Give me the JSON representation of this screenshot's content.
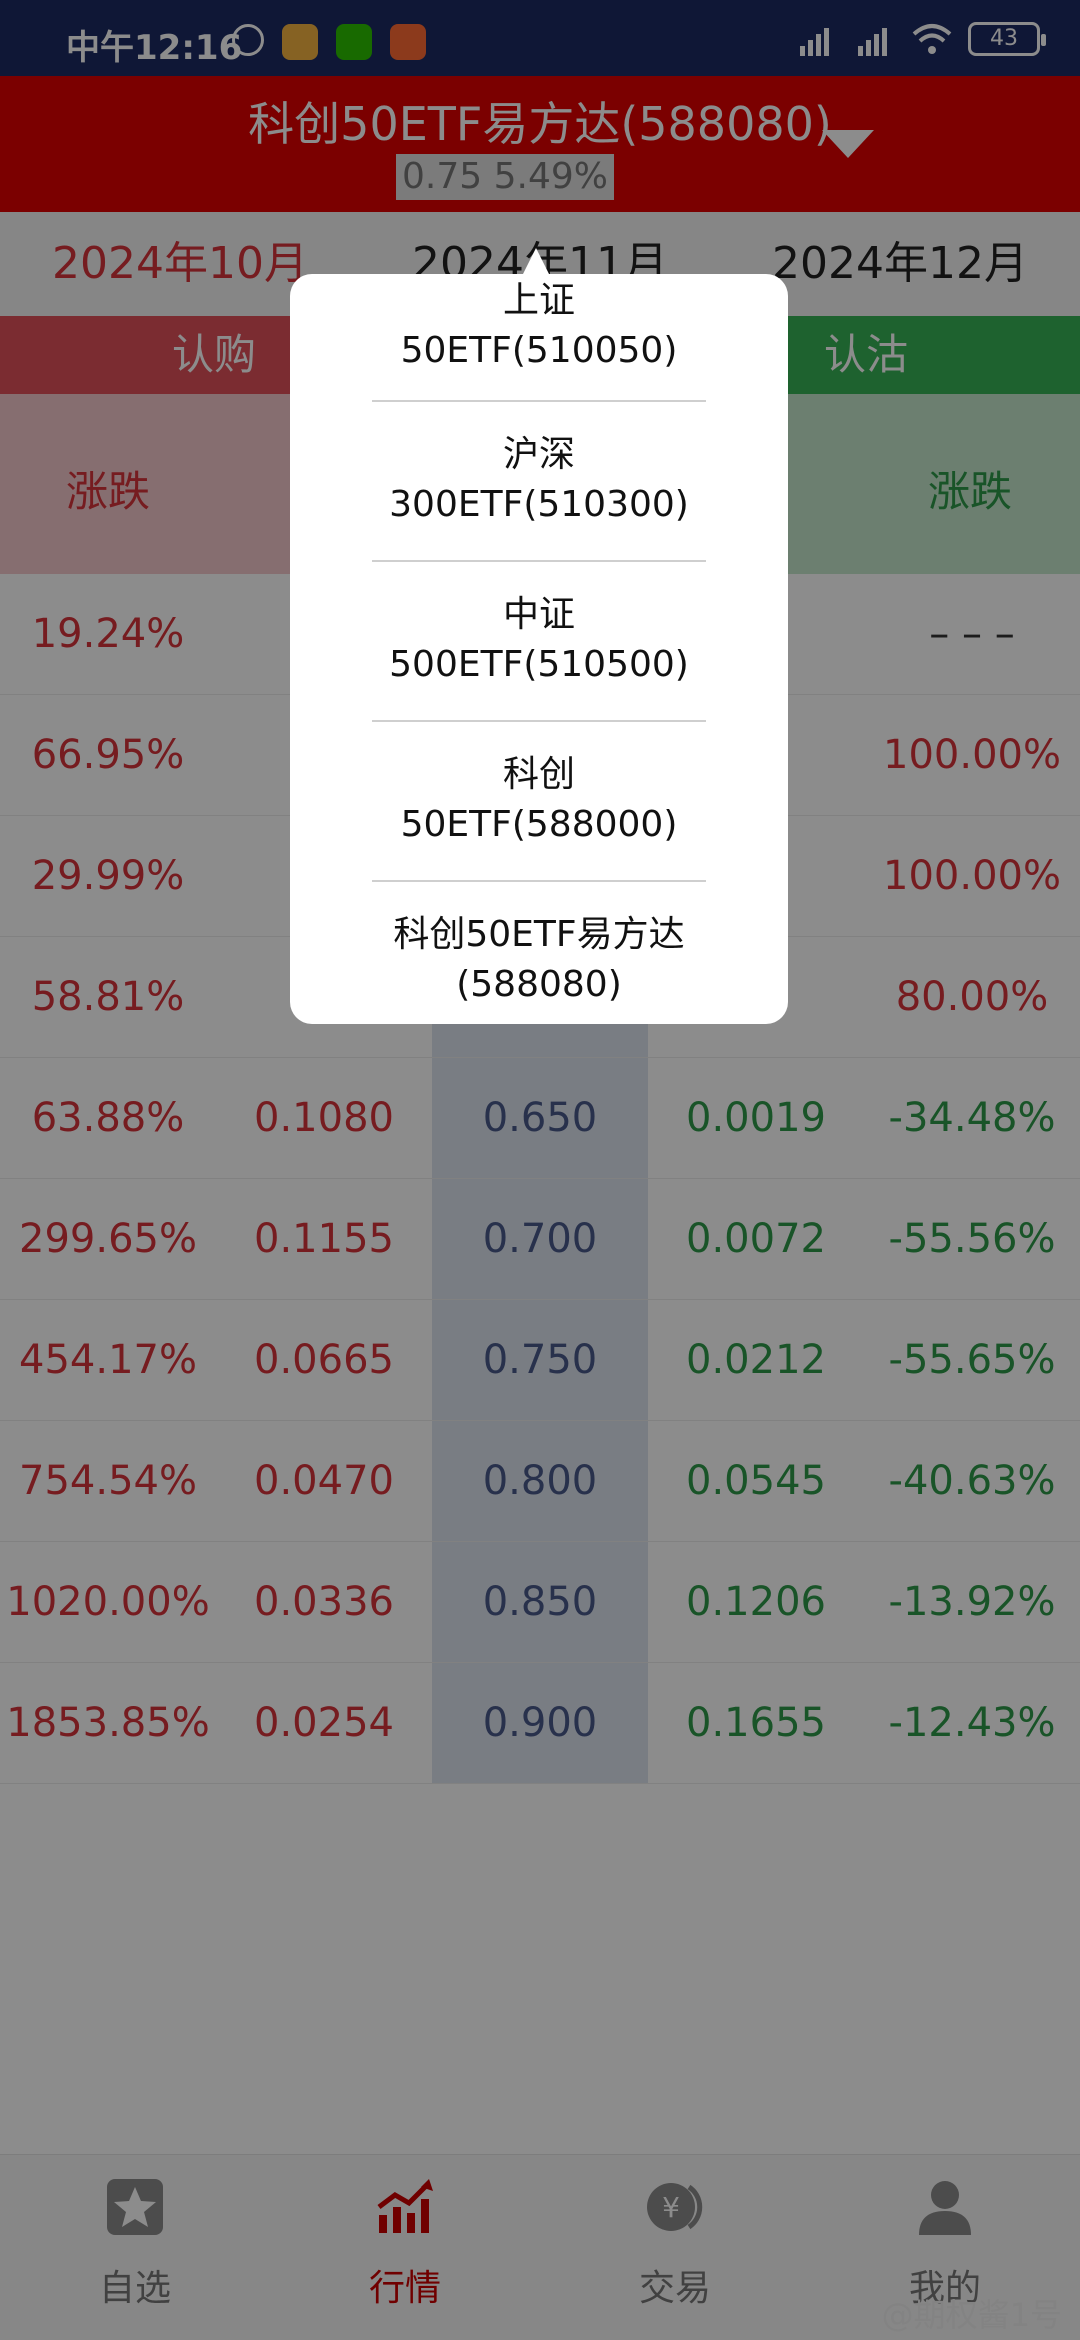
{
  "status_bar": {
    "time": "中午12:16",
    "battery": "43"
  },
  "header": {
    "title": "科创50ETF易方达(588080)",
    "subtitle": "0.75 5.49%"
  },
  "months": [
    {
      "label": "2024年10月"
    },
    {
      "label": "2024年11月"
    },
    {
      "label": "2024年12月"
    }
  ],
  "call_label": "认购",
  "put_label": "认沽",
  "columns": {
    "call_change": "涨跌",
    "put_change": "涨跌"
  },
  "rows": [
    {
      "call_change": "19.24%",
      "call_price": "",
      "strike": "",
      "put_price": "",
      "put_change": "– – –"
    },
    {
      "call_change": "66.95%",
      "call_price": "",
      "strike": "",
      "put_price": "",
      "put_change": "100.00%"
    },
    {
      "call_change": "29.99%",
      "call_price": "",
      "strike": "",
      "put_price": "",
      "put_change": "100.00%"
    },
    {
      "call_change": "58.81%",
      "call_price": "",
      "strike": "",
      "put_price": "",
      "put_change": "80.00%"
    },
    {
      "call_change": "63.88%",
      "call_price": "0.1080",
      "strike": "0.650",
      "put_price": "0.0019",
      "put_change": "-34.48%"
    },
    {
      "call_change": "299.65%",
      "call_price": "0.1155",
      "strike": "0.700",
      "put_price": "0.0072",
      "put_change": "-55.56%"
    },
    {
      "call_change": "454.17%",
      "call_price": "0.0665",
      "strike": "0.750",
      "put_price": "0.0212",
      "put_change": "-55.65%"
    },
    {
      "call_change": "754.54%",
      "call_price": "0.0470",
      "strike": "0.800",
      "put_price": "0.0545",
      "put_change": "-40.63%"
    },
    {
      "call_change": "1020.00%",
      "call_price": "0.0336",
      "strike": "0.850",
      "put_price": "0.1206",
      "put_change": "-13.92%"
    },
    {
      "call_change": "1853.85%",
      "call_price": "0.0254",
      "strike": "0.900",
      "put_price": "0.1655",
      "put_change": "-12.43%"
    }
  ],
  "popup": {
    "items": [
      {
        "line1": "上证",
        "line2": "50ETF(510050)"
      },
      {
        "line1": "沪深",
        "line2": "300ETF(510300)"
      },
      {
        "line1": "中证",
        "line2": "500ETF(510500)"
      },
      {
        "line1": "科创",
        "line2": "50ETF(588000)"
      },
      {
        "line1": "科创50ETF易方达",
        "line2": "(588080)"
      }
    ]
  },
  "nav": [
    {
      "label": "自选",
      "icon": "star-icon"
    },
    {
      "label": "行情",
      "icon": "chart-icon"
    },
    {
      "label": "交易",
      "icon": "yen-icon"
    },
    {
      "label": "我的",
      "icon": "user-icon"
    }
  ],
  "watermark": "@期权酱1号"
}
